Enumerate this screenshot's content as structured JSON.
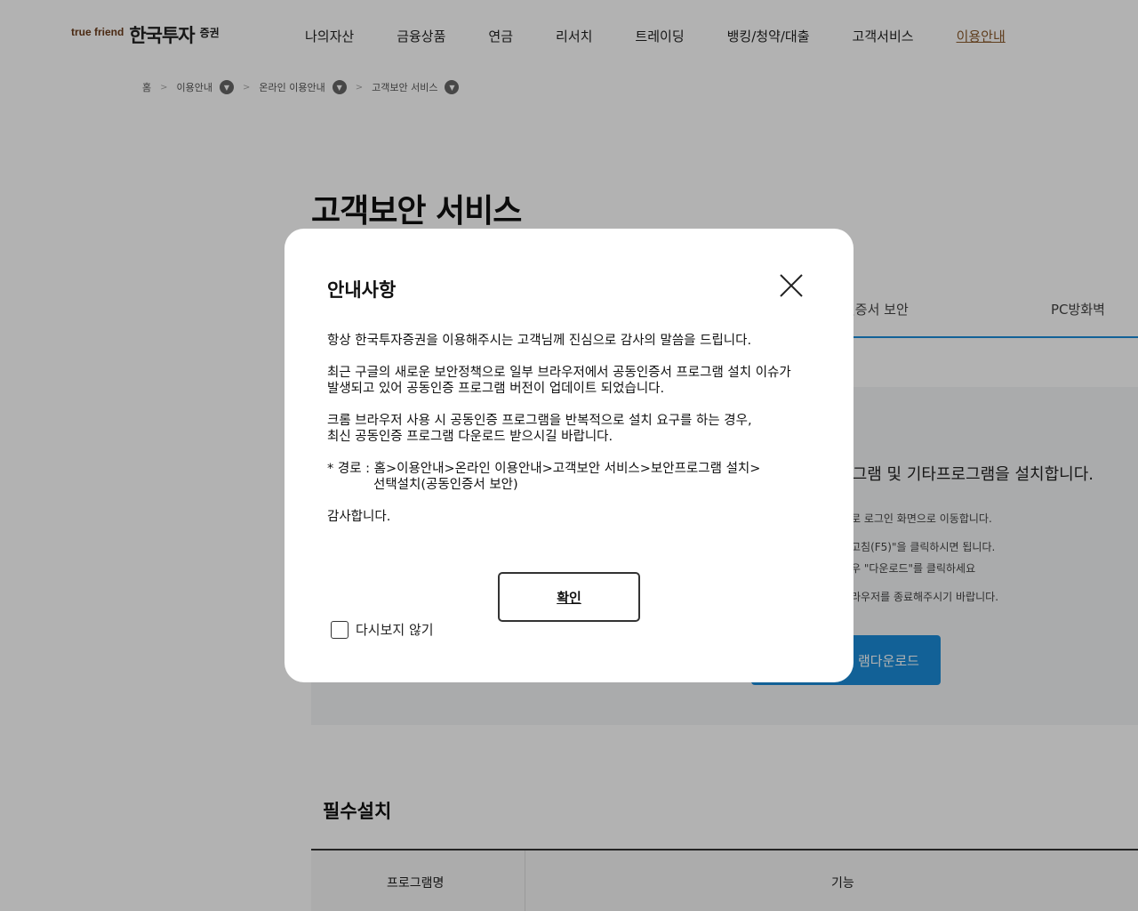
{
  "header": {
    "logo_true": "true friend",
    "logo_name": "한국투자",
    "logo_sub": "증권",
    "nav": [
      "나의자산",
      "금융상품",
      "연금",
      "리서치",
      "트레이딩",
      "뱅킹/청약/대출",
      "고객서비스",
      "이용안내"
    ],
    "nav_active": "이용안내"
  },
  "breadcrumb": {
    "home": "홈",
    "items": [
      "이용안내",
      "온라인 이용안내",
      "고객보안 서비스"
    ]
  },
  "page": {
    "title": "고객보안 서비스",
    "tabs": [
      "인증서 보안",
      "PC방화벽"
    ],
    "info_heading": "로그램 및 기타프로그램을 설치합니다.",
    "info_lines": [
      "로 로그인 화면으로 이동합니다.",
      "고침(F5)\"을 클릭하시면 됩니다.",
      "우 \"다운로드\"를 클릭하세요",
      "라우저를 종료해주시기 바랍니다."
    ],
    "download_button": "램다운로드",
    "required_title": "필수설치",
    "table_headers": [
      "프로그램명",
      "기능"
    ]
  },
  "modal": {
    "title": "안내사항",
    "para1": "항상 한국투자증권을 이용해주시는 고객님께 진심으로 감사의 말씀을 드립니다.",
    "para2_line1": "최근 구글의 새로운 보안정책으로 일부 브라우저에서 공동인증서 프로그램 설치 이슈가",
    "para2_line2": "발생되고 있어 공동인증 프로그램 버전이 업데이트 되었습니다.",
    "para3_line1": "크롬 브라우저 사용 시 공동인증 프로그램을 반복적으로 설치 요구를 하는 경우,",
    "para3_line2": "최신 공동인증 프로그램 다운로드 받으시길 바랍니다.",
    "path_line1": "* 경로 : 홈>이용안내>온라인 이용안내>고객보안 서비스>보안프로그램 설치>",
    "path_line2": "선택설치(공동인증서 보안)",
    "thanks": "감사합니다.",
    "confirm": "확인",
    "no_show": "다시보지 않기"
  },
  "colors": {
    "accent_blue": "#1a8cd8",
    "nav_active": "#8a5a2b",
    "dim_overlay": "rgba(0,0,0,0.3)"
  }
}
